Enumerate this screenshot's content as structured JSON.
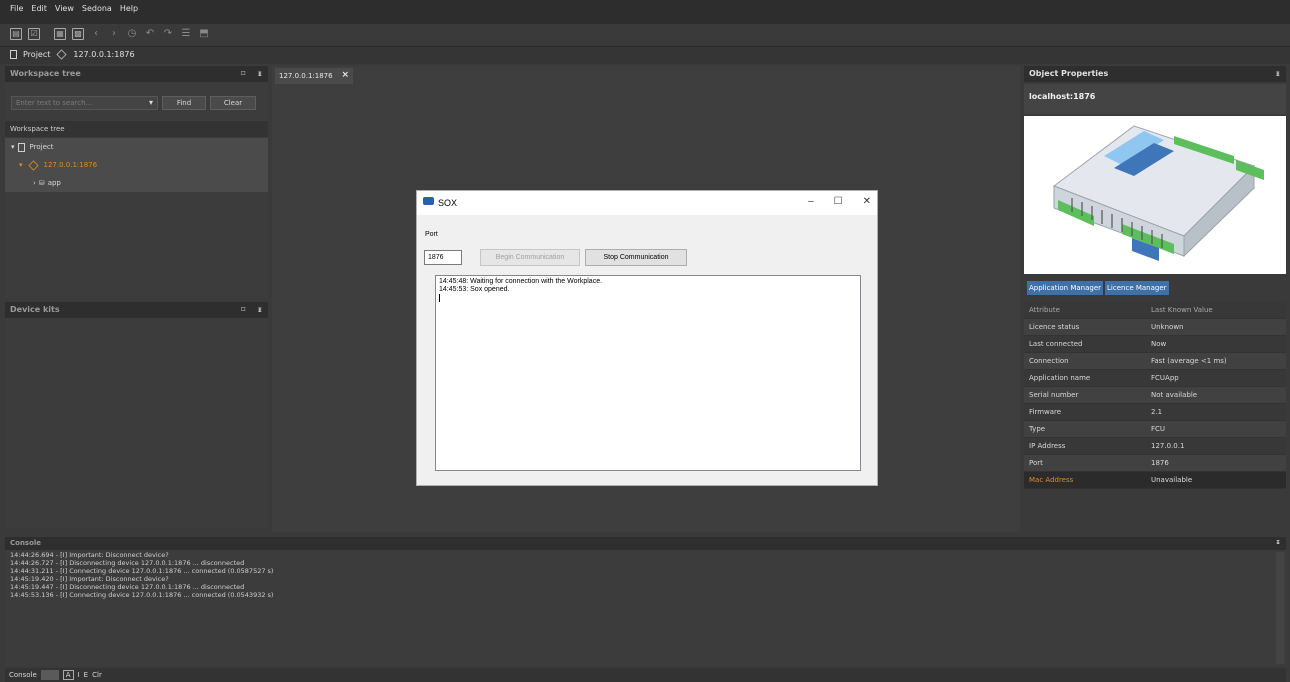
{
  "menu": [
    "File",
    "Edit",
    "View",
    "Sedona",
    "Help"
  ],
  "toolbar_icons": [
    "window-icon",
    "checklist-icon",
    "grid-icon",
    "grid-alt-icon",
    "back-icon",
    "forward-icon",
    "history-icon",
    "undo-icon",
    "redo-icon",
    "list-icon",
    "deploy-icon"
  ],
  "breadcrumb": {
    "project": "Project",
    "device": "127.0.0.1:1876"
  },
  "workspace_tree": {
    "header": "Workspace tree",
    "search_placeholder": "Enter text to search...",
    "find": "Find",
    "clear": "Clear",
    "subheader": "Workspace tree",
    "items": [
      {
        "label": "Project"
      },
      {
        "label": "127.0.0.1:1876"
      },
      {
        "label": "app"
      }
    ]
  },
  "device_kits": {
    "header": "Device kits"
  },
  "editor_tab": {
    "label": "127.0.0.1:1876"
  },
  "sox_dialog": {
    "title": "SOX",
    "port_label": "Port",
    "port_value": "1876",
    "begin_btn": "Begin Communication",
    "stop_btn": "Stop Communication",
    "log": [
      "14:45:48: Waiting for connection with the Workplace.",
      "14:45:53: Sox opened."
    ]
  },
  "object_properties": {
    "header": "Object Properties",
    "title": "localhost:1876",
    "tabs": [
      "Application Manager",
      "Licence Manager"
    ],
    "col_attr": "Attribute",
    "col_val": "Last Known Value",
    "rows": [
      {
        "k": "Licence status",
        "v": "Unknown"
      },
      {
        "k": "Last connected",
        "v": "Now"
      },
      {
        "k": "Connection",
        "v": "Fast (average <1 ms)"
      },
      {
        "k": "Application name",
        "v": "FCUApp"
      },
      {
        "k": "Serial number",
        "v": "Not available"
      },
      {
        "k": "Firmware",
        "v": "2.1"
      },
      {
        "k": "Type",
        "v": "FCU"
      },
      {
        "k": "IP Address",
        "v": "127.0.0.1"
      },
      {
        "k": "Port",
        "v": "1876"
      },
      {
        "k": "Mac Address",
        "v": "Unavailable"
      }
    ]
  },
  "console": {
    "header": "Console",
    "lines": [
      "14:44:26.694 - [I] Important: Disconnect device?",
      "14:44:26.727 - [I] Disconnecting device 127.0.0.1:1876 ... disconnected",
      "14:44:31.211 - [I] Connecting device 127.0.0.1:1876 ... connected (0.0587527 s)",
      "14:45:19.420 - [I] Important: Disconnect device?",
      "14:45:19.447 - [I] Disconnecting device 127.0.0.1:1876 ... disconnected",
      "14:45:53.136 - [I] Connecting device 127.0.0.1:1876 ... connected (0.0543932 s)"
    ],
    "footer_label": "Console",
    "footer_a": "A",
    "footer_i": "I",
    "footer_e": "E",
    "footer_clr": "Clr"
  },
  "colors": {
    "accent_orange": "#e08a2c",
    "tab_blue": "#3f70a8"
  }
}
